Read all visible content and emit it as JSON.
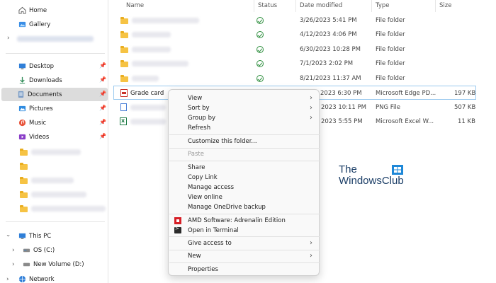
{
  "sidebar": {
    "top_items": [
      {
        "label": "Home",
        "icon": "home-icon"
      },
      {
        "label": "Gallery",
        "icon": "gallery-icon"
      }
    ],
    "quick_access": [
      {
        "label": "Desktop",
        "icon": "desktop-icon",
        "pinned": true
      },
      {
        "label": "Downloads",
        "icon": "download-icon",
        "pinned": true
      },
      {
        "label": "Documents",
        "icon": "documents-icon",
        "pinned": true,
        "selected": true
      },
      {
        "label": "Pictures",
        "icon": "pictures-icon",
        "pinned": true
      },
      {
        "label": "Music",
        "icon": "music-icon",
        "pinned": true
      },
      {
        "label": "Videos",
        "icon": "videos-icon",
        "pinned": true
      }
    ],
    "this_pc": {
      "label": "This PC",
      "icon": "computer-icon"
    },
    "drives": [
      {
        "label": "OS (C:)",
        "icon": "drive-icon"
      },
      {
        "label": "New Volume (D:)",
        "icon": "drive-icon"
      }
    ],
    "network": {
      "label": "Network",
      "icon": "network-icon"
    }
  },
  "file_list": {
    "columns": [
      "Name",
      "Status",
      "Date modified",
      "Type",
      "Size"
    ],
    "rows": [
      {
        "name": "",
        "date": "3/26/2023 5:41 PM",
        "type": "File folder",
        "size": ""
      },
      {
        "name": "",
        "date": "4/12/2023 4:06 PM",
        "type": "File folder",
        "size": ""
      },
      {
        "name": "",
        "date": "6/30/2023 10:28 PM",
        "type": "File folder",
        "size": ""
      },
      {
        "name": "",
        "date": "7/1/2023 2:02 PM",
        "type": "File folder",
        "size": ""
      },
      {
        "name": "",
        "date": "8/21/2023 11:37 AM",
        "type": "File folder",
        "size": ""
      },
      {
        "name": "Grade card",
        "date": "2023 6:30 PM",
        "type": "Microsoft Edge PD...",
        "size": "197 KB"
      },
      {
        "name": "",
        "date": "2023 10:11 PM",
        "type": "PNG File",
        "size": "507 KB"
      },
      {
        "name": "",
        "date": "2023 5:55 PM",
        "type": "Microsoft Excel W...",
        "size": "11 KB"
      }
    ]
  },
  "context_menu": {
    "view": "View",
    "sort_by": "Sort by",
    "group_by": "Group by",
    "refresh": "Refresh",
    "customize": "Customize this folder...",
    "paste": "Paste",
    "share": "Share",
    "copy_link": "Copy Link",
    "manage_access": "Manage access",
    "view_online": "View online",
    "manage_onedrive": "Manage OneDrive backup",
    "amd": "AMD Software: Adrenalin Edition",
    "terminal": "Open in Terminal",
    "give_access": "Give access to",
    "new": "New",
    "properties": "Properties"
  },
  "watermark": {
    "line1": "The",
    "line2": "WindowsClub"
  },
  "colors": {
    "selection": "#dcdcdc",
    "row_highlight_border": "#99c9ef",
    "status_ok": "#2f8f3f",
    "folder": "#f6c344",
    "amd_red": "#d61f26"
  }
}
